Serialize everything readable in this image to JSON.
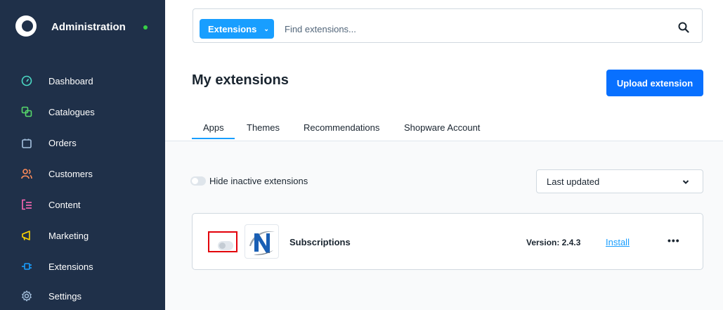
{
  "sidebar": {
    "title": "Administration",
    "status_color": "#37d046",
    "items": [
      {
        "label": "Dashboard",
        "icon": "gauge-icon",
        "color": "#4bd9c4"
      },
      {
        "label": "Catalogues",
        "icon": "catalogue-icon",
        "color": "#57d96b"
      },
      {
        "label": "Orders",
        "icon": "shopping-bag-icon",
        "color": "#a6c2e0"
      },
      {
        "label": "Customers",
        "icon": "customers-icon",
        "color": "#ff8c5a"
      },
      {
        "label": "Content",
        "icon": "content-icon",
        "color": "#ff68b4"
      },
      {
        "label": "Marketing",
        "icon": "megaphone-icon",
        "color": "#ffd700"
      },
      {
        "label": "Extensions",
        "icon": "plug-icon",
        "color": "#189eff"
      },
      {
        "label": "Settings",
        "icon": "gear-icon",
        "color": "#a6c2e0"
      }
    ]
  },
  "search": {
    "type_label": "Extensions",
    "placeholder": "Find extensions..."
  },
  "header": {
    "title": "My extensions",
    "upload_label": "Upload extension"
  },
  "tabs": [
    "Apps",
    "Themes",
    "Recommendations",
    "Shopware Account"
  ],
  "active_tab": "Apps",
  "toolbar": {
    "toggle_label": "Hide inactive extensions",
    "sort_value": "Last updated"
  },
  "extensions": [
    {
      "name": "Subscriptions",
      "version": "Version: 2.4.3",
      "action": "Install",
      "more": "•••",
      "active": false
    }
  ],
  "colors": {
    "sidebar_bg": "#1f3049",
    "accent": "#189eff",
    "primary_button": "#0870ff",
    "highlight": "#e3000b"
  }
}
